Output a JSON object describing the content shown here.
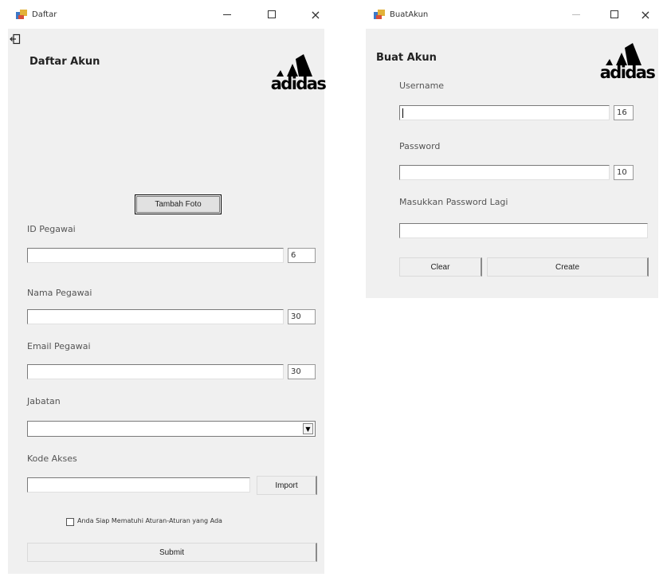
{
  "daftar": {
    "title": "Daftar",
    "heading": "Daftar Akun",
    "logo_text": "adidas",
    "tambah_foto": "Tambah Foto",
    "id_label": "ID Pegawai",
    "id_count": "6",
    "nama_label": "Nama Pegawai",
    "nama_count": "30",
    "email_label": "Email Pegawai",
    "email_count": "30",
    "jabatan_label": "Jabatan",
    "kode_label": "Kode Akses",
    "import": "Import",
    "checkbox_label": "Anda Siap Mematuhi Aturan-Aturan yang Ada",
    "submit": "Submit"
  },
  "buat": {
    "title": "BuatAkun",
    "heading": "Buat Akun",
    "logo_text": "adidas",
    "username_label": "Username",
    "username_count": "16",
    "password_label": "Password",
    "password_count": "10",
    "confirm_label": "Masukkan Password Lagi",
    "clear": "Clear",
    "create": "Create"
  },
  "icons": {
    "minimize": "minimize-icon",
    "maximize": "maximize-icon",
    "close": "close-icon",
    "back": "exit-icon"
  }
}
